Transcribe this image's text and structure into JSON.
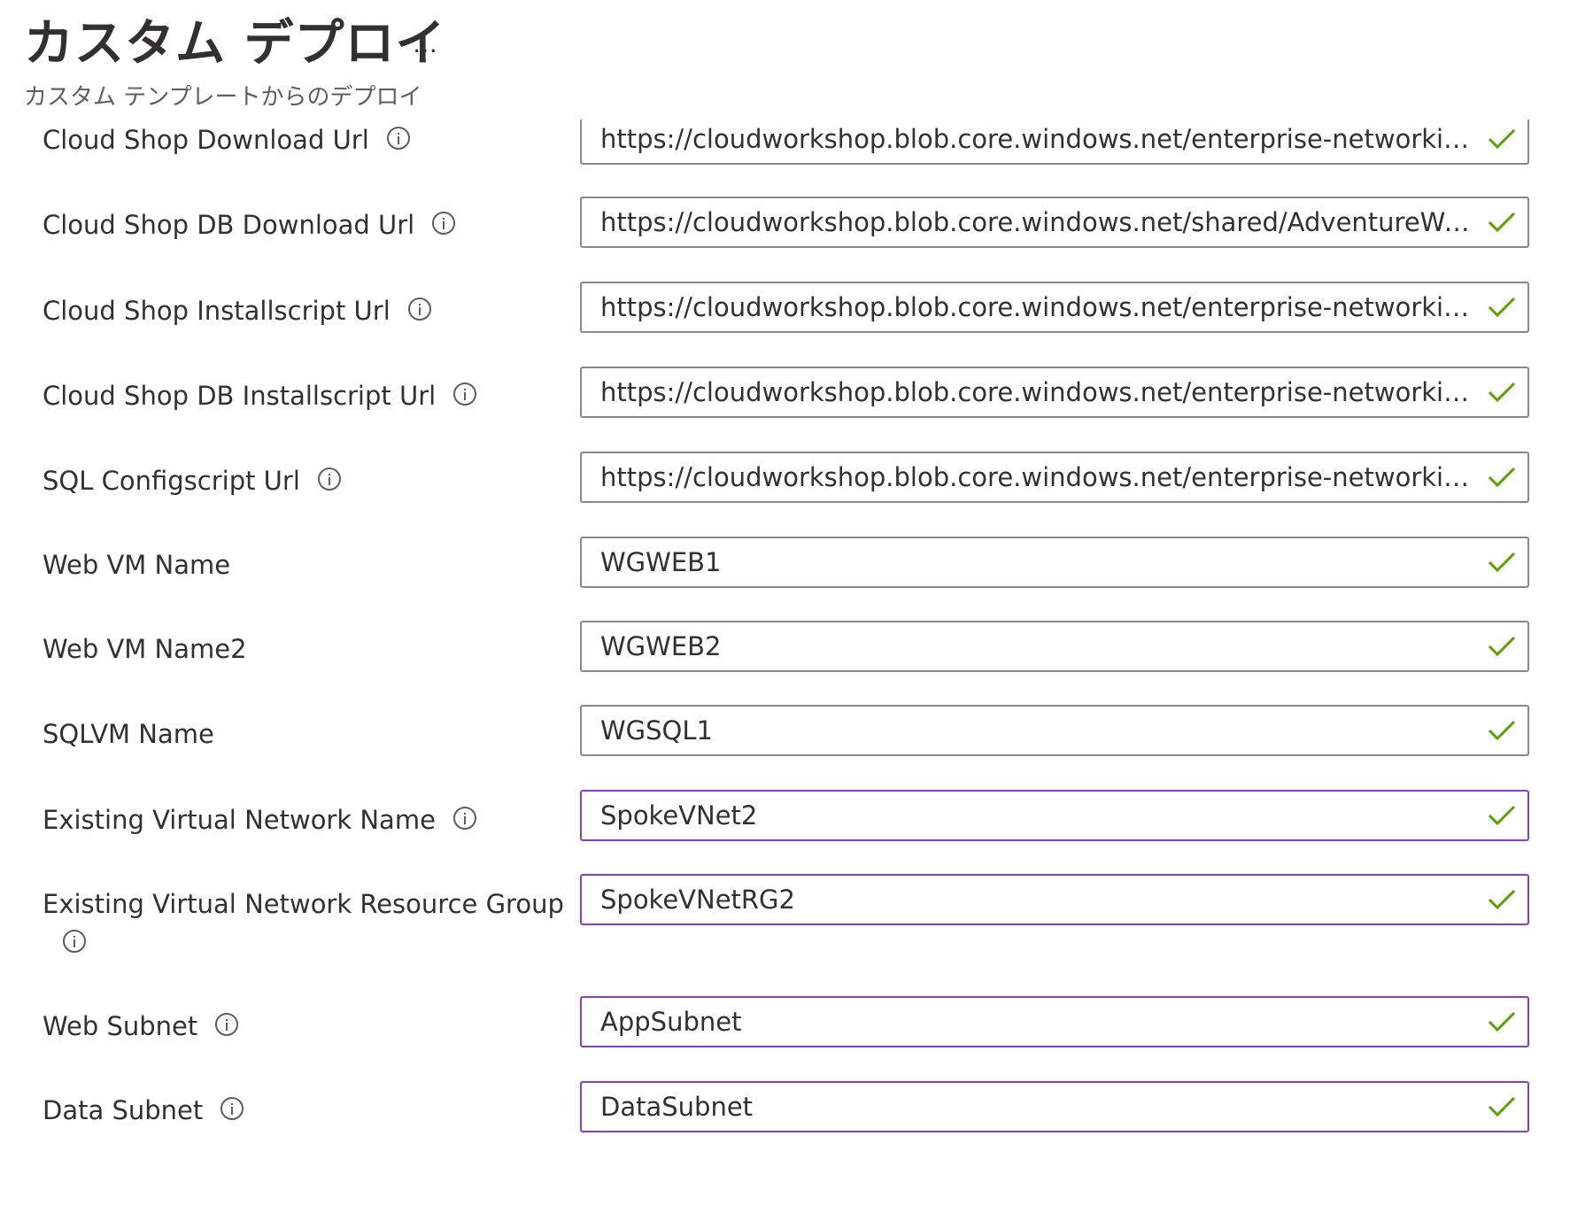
{
  "header": {
    "title": "カスタム デプロイ",
    "more_label": "…",
    "subtitle": "カスタム テンプレートからのデプロイ"
  },
  "colors": {
    "check": "#57a300",
    "active_border": "#8a3ec5",
    "default_border": "#8a8886"
  },
  "form": {
    "fields": [
      {
        "label": "Cloud Shop Download Url",
        "value": "https://cloudworkshop.blob.core.windows.net/enterprise-networking/...",
        "info": true,
        "valid": true
      },
      {
        "label": "Cloud Shop DB Download Url",
        "value": "https://cloudworkshop.blob.core.windows.net/shared/AdventureWork...",
        "info": true,
        "valid": true
      },
      {
        "label": "Cloud Shop Installscript Url",
        "value": "https://cloudworkshop.blob.core.windows.net/enterprise-networking/...",
        "info": true,
        "valid": true
      },
      {
        "label": "Cloud Shop DB Installscript Url",
        "value": "https://cloudworkshop.blob.core.windows.net/enterprise-networking/...",
        "info": true,
        "valid": true
      },
      {
        "label": "SQL Configscript Url",
        "value": "https://cloudworkshop.blob.core.windows.net/enterprise-networking/...",
        "info": true,
        "valid": true
      },
      {
        "label": "Web VM Name",
        "value": "WGWEB1",
        "info": false,
        "valid": true
      },
      {
        "label": "Web VM Name2",
        "value": "WGWEB2",
        "info": false,
        "valid": true
      },
      {
        "label": "SQLVM Name",
        "value": "WGSQL1",
        "info": false,
        "valid": true
      },
      {
        "label": "Existing Virtual Network Name",
        "value": "SpokeVNet2",
        "info": true,
        "valid": true
      },
      {
        "label": "Existing Virtual Network Resource Group",
        "value": "SpokeVNetRG2",
        "info": true,
        "valid": true
      },
      {
        "label": "Web Subnet",
        "value": "AppSubnet",
        "info": true,
        "valid": true
      },
      {
        "label": "Data Subnet",
        "value": "DataSubnet",
        "info": true,
        "valid": true
      }
    ]
  }
}
